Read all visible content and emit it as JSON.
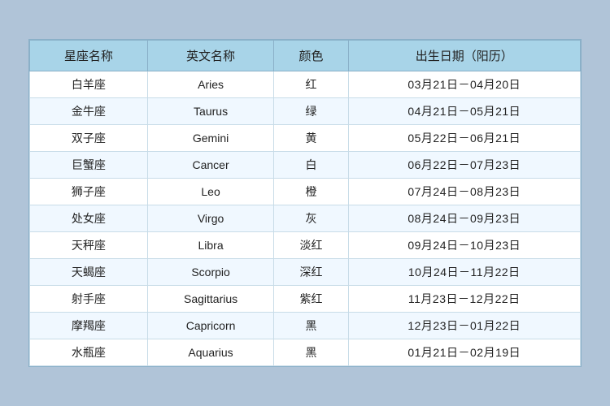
{
  "table": {
    "headers": [
      "星座名称",
      "英文名称",
      "颜色",
      "出生日期（阳历）"
    ],
    "rows": [
      {
        "chinese": "白羊座",
        "english": "Aries",
        "color": "红",
        "dates": "03月21日－04月20日"
      },
      {
        "chinese": "金牛座",
        "english": "Taurus",
        "color": "绿",
        "dates": "04月21日－05月21日"
      },
      {
        "chinese": "双子座",
        "english": "Gemini",
        "color": "黄",
        "dates": "05月22日－06月21日"
      },
      {
        "chinese": "巨蟹座",
        "english": "Cancer",
        "color": "白",
        "dates": "06月22日－07月23日"
      },
      {
        "chinese": "狮子座",
        "english": "Leo",
        "color": "橙",
        "dates": "07月24日－08月23日"
      },
      {
        "chinese": "处女座",
        "english": "Virgo",
        "color": "灰",
        "dates": "08月24日－09月23日"
      },
      {
        "chinese": "天秤座",
        "english": "Libra",
        "color": "淡红",
        "dates": "09月24日－10月23日"
      },
      {
        "chinese": "天蝎座",
        "english": "Scorpio",
        "color": "深红",
        "dates": "10月24日－11月22日"
      },
      {
        "chinese": "射手座",
        "english": "Sagittarius",
        "color": "紫红",
        "dates": "11月23日－12月22日"
      },
      {
        "chinese": "摩羯座",
        "english": "Capricorn",
        "color": "黑",
        "dates": "12月23日－01月22日"
      },
      {
        "chinese": "水瓶座",
        "english": "Aquarius",
        "color": "黑",
        "dates": "01月21日－02月19日"
      }
    ]
  }
}
